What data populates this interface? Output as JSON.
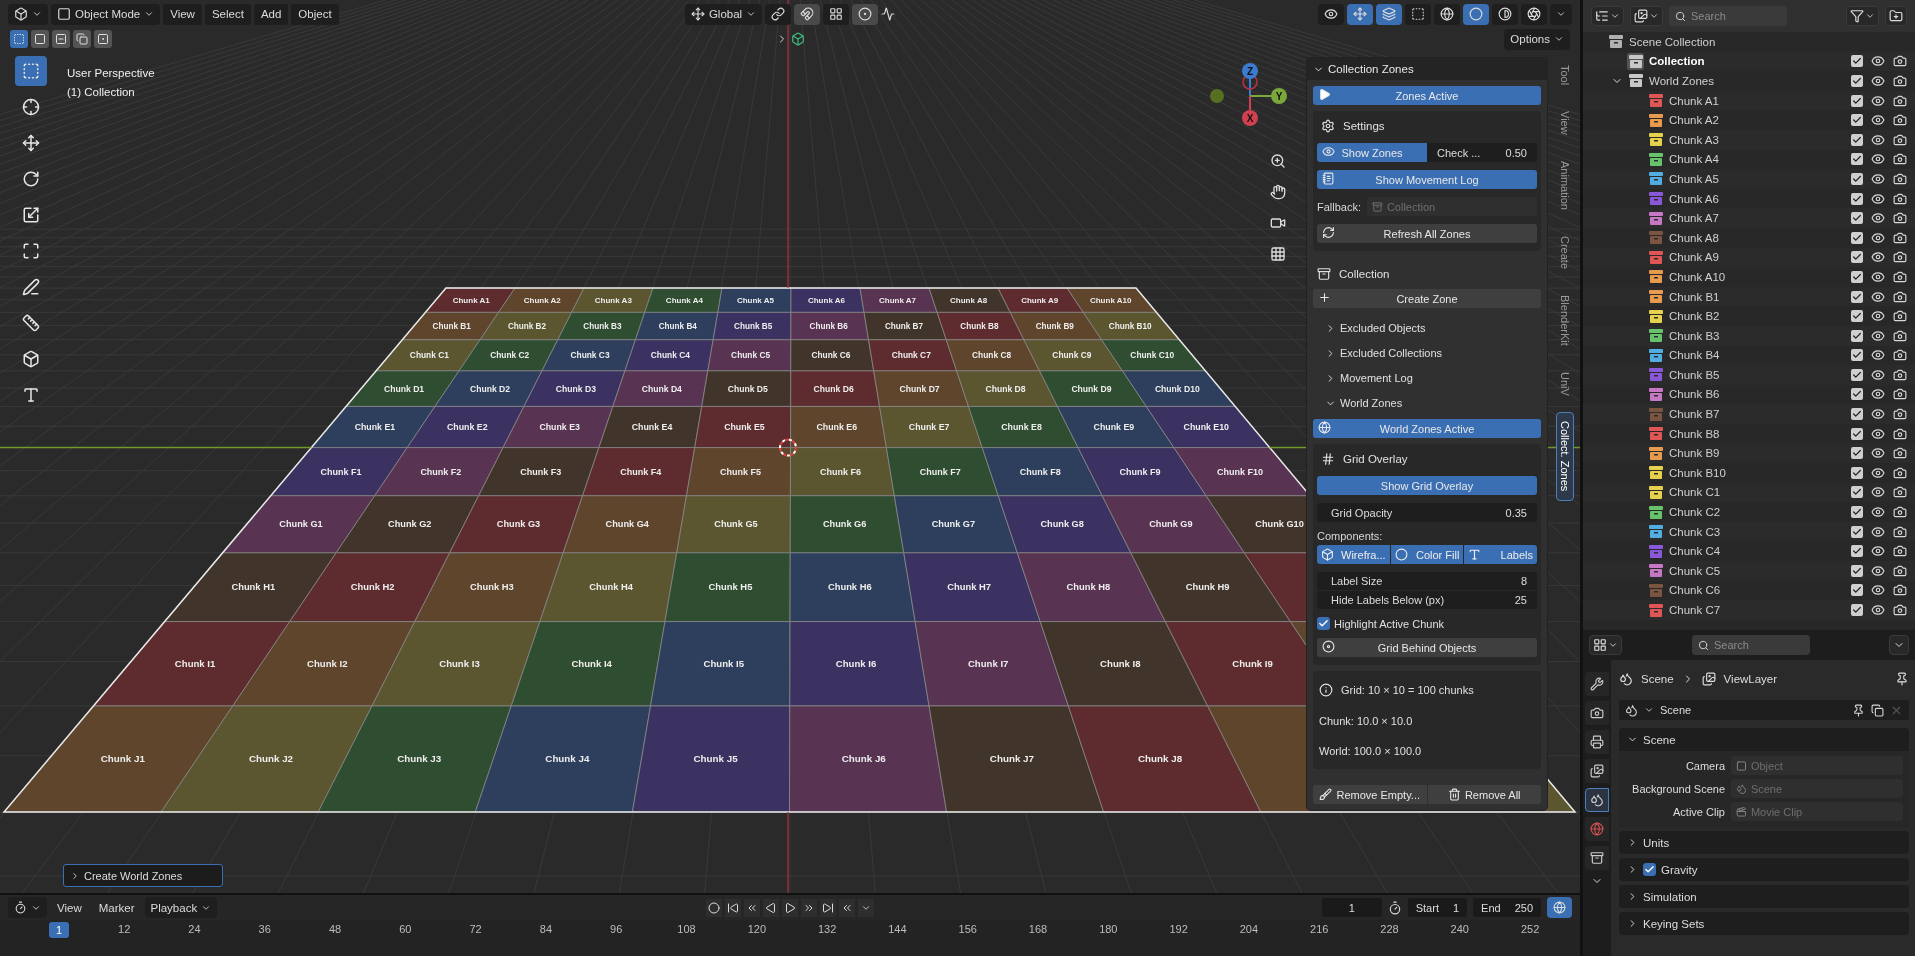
{
  "header": {
    "mode": "Object Mode",
    "menus": [
      "View",
      "Select",
      "Add",
      "Object"
    ],
    "orientation": "Global",
    "center_tools": [
      {
        "kind": "pivot",
        "on": false
      },
      {
        "kind": "snap",
        "on": true
      },
      {
        "kind": "increment",
        "on": false
      },
      {
        "kind": "proportional",
        "on": true
      }
    ],
    "toggles": [
      {
        "kind": "visibility",
        "on": false
      },
      {
        "kind": "gizmo",
        "on": true
      },
      {
        "kind": "overlay",
        "on": true
      },
      {
        "kind": "xray",
        "on": false
      }
    ],
    "shading": [
      {
        "kind": "wireframe",
        "selected": false
      },
      {
        "kind": "solid",
        "selected": true
      },
      {
        "kind": "material",
        "selected": false
      },
      {
        "kind": "rendered",
        "selected": false
      }
    ]
  },
  "select_modes": [
    {
      "selected": true
    },
    {
      "selected": false
    },
    {
      "selected": false
    },
    {
      "selected": false
    },
    {
      "selected": false
    }
  ],
  "options": "Options",
  "viewport": {
    "perspective": "User Perspective",
    "collection": "(1) Collection",
    "gizmo_axes": [
      "Z",
      "Y",
      "X"
    ],
    "redo_panel": "Create World Zones"
  },
  "tools": [
    {
      "kind": "select",
      "selected": true
    },
    {
      "kind": "cursor",
      "selected": false
    },
    {
      "kind": "move",
      "selected": false
    },
    {
      "kind": "rotate",
      "selected": false
    },
    {
      "kind": "scale",
      "selected": false
    },
    {
      "kind": "transform",
      "selected": false
    },
    {
      "kind": "annotate",
      "selected": false
    },
    {
      "kind": "measure",
      "selected": false
    },
    {
      "kind": "add-cube",
      "selected": false
    },
    {
      "kind": "uv",
      "selected": false
    }
  ],
  "grid": {
    "rows": [
      {
        "cells": [
          {
            "label": "Chunk A1",
            "color": "#5e2c2e"
          },
          {
            "label": "Chunk A2",
            "color": "#5f452c"
          },
          {
            "label": "Chunk A3",
            "color": "#5b5530"
          },
          {
            "label": "Chunk A4",
            "color": "#2f4d30"
          },
          {
            "label": "Chunk A5",
            "color": "#2d3f5d"
          },
          {
            "label": "Chunk A6",
            "color": "#3c3262"
          },
          {
            "label": "Chunk A7",
            "color": "#583352"
          },
          {
            "label": "Chunk A8",
            "color": "#41342b"
          },
          {
            "label": "Chunk A9",
            "color": "#5e2c2e"
          },
          {
            "label": "Chunk A10",
            "color": "#5f452c"
          }
        ]
      },
      {
        "cells": [
          {
            "label": "Chunk B1",
            "color": "#5f452c"
          },
          {
            "label": "Chunk B2",
            "color": "#5b5530"
          },
          {
            "label": "Chunk B3",
            "color": "#2f4d30"
          },
          {
            "label": "Chunk B4",
            "color": "#2d3f5d"
          },
          {
            "label": "Chunk B5",
            "color": "#3c3262"
          },
          {
            "label": "Chunk B6",
            "color": "#583352"
          },
          {
            "label": "Chunk B7",
            "color": "#41342b"
          },
          {
            "label": "Chunk B8",
            "color": "#5e2c2e"
          },
          {
            "label": "Chunk B9",
            "color": "#5f452c"
          },
          {
            "label": "Chunk B10",
            "color": "#5b5530"
          }
        ]
      },
      {
        "cells": [
          {
            "label": "Chunk C1",
            "color": "#5b5530"
          },
          {
            "label": "Chunk C2",
            "color": "#2f4d30"
          },
          {
            "label": "Chunk C3",
            "color": "#2d3f5d"
          },
          {
            "label": "Chunk C4",
            "color": "#3c3262"
          },
          {
            "label": "Chunk C5",
            "color": "#583352"
          },
          {
            "label": "Chunk C6",
            "color": "#41342b"
          },
          {
            "label": "Chunk C7",
            "color": "#5e2c2e"
          },
          {
            "label": "Chunk C8",
            "color": "#5f452c"
          },
          {
            "label": "Chunk C9",
            "color": "#5b5530"
          },
          {
            "label": "Chunk C10",
            "color": "#2f4d30"
          }
        ]
      },
      {
        "cells": [
          {
            "label": "Chunk D1",
            "color": "#2f4d30"
          },
          {
            "label": "Chunk D2",
            "color": "#2d3f5d"
          },
          {
            "label": "Chunk D3",
            "color": "#3c3262"
          },
          {
            "label": "Chunk D4",
            "color": "#583352"
          },
          {
            "label": "Chunk D5",
            "color": "#41342b"
          },
          {
            "label": "Chunk D6",
            "color": "#5e2c2e"
          },
          {
            "label": "Chunk D7",
            "color": "#5f452c"
          },
          {
            "label": "Chunk D8",
            "color": "#5b5530"
          },
          {
            "label": "Chunk D9",
            "color": "#2f4d30"
          },
          {
            "label": "Chunk D10",
            "color": "#2d3f5d"
          }
        ]
      },
      {
        "cells": [
          {
            "label": "Chunk E1",
            "color": "#2d3f5d"
          },
          {
            "label": "Chunk E2",
            "color": "#3c3262"
          },
          {
            "label": "Chunk E3",
            "color": "#583352"
          },
          {
            "label": "Chunk E4",
            "color": "#41342b"
          },
          {
            "label": "Chunk E5",
            "color": "#5e2c2e"
          },
          {
            "label": "Chunk E6",
            "color": "#5f452c"
          },
          {
            "label": "Chunk E7",
            "color": "#5b5530"
          },
          {
            "label": "Chunk E8",
            "color": "#2f4d30"
          },
          {
            "label": "Chunk E9",
            "color": "#2d3f5d"
          },
          {
            "label": "Chunk E10",
            "color": "#3c3262"
          }
        ]
      },
      {
        "cells": [
          {
            "label": "Chunk F1",
            "color": "#3c3262"
          },
          {
            "label": "Chunk F2",
            "color": "#583352"
          },
          {
            "label": "Chunk F3",
            "color": "#41342b"
          },
          {
            "label": "Chunk F4",
            "color": "#5e2c2e"
          },
          {
            "label": "Chunk F5",
            "color": "#5f452c"
          },
          {
            "label": "Chunk F6",
            "color": "#5b5530"
          },
          {
            "label": "Chunk F7",
            "color": "#2f4d30"
          },
          {
            "label": "Chunk F8",
            "color": "#2d3f5d"
          },
          {
            "label": "Chunk F9",
            "color": "#3c3262"
          },
          {
            "label": "Chunk F10",
            "color": "#583352"
          }
        ]
      },
      {
        "cells": [
          {
            "label": "Chunk G1",
            "color": "#583352"
          },
          {
            "label": "Chunk G2",
            "color": "#41342b"
          },
          {
            "label": "Chunk G3",
            "color": "#5e2c2e"
          },
          {
            "label": "Chunk G4",
            "color": "#5f452c"
          },
          {
            "label": "Chunk G5",
            "color": "#5b5530"
          },
          {
            "label": "Chunk G6",
            "color": "#2f4d30"
          },
          {
            "label": "Chunk G7",
            "color": "#2d3f5d"
          },
          {
            "label": "Chunk G8",
            "color": "#3c3262"
          },
          {
            "label": "Chunk G9",
            "color": "#583352"
          },
          {
            "label": "Chunk G10",
            "color": "#41342b"
          }
        ]
      },
      {
        "cells": [
          {
            "label": "Chunk H1",
            "color": "#41342b"
          },
          {
            "label": "Chunk H2",
            "color": "#5e2c2e"
          },
          {
            "label": "Chunk H3",
            "color": "#5f452c"
          },
          {
            "label": "Chunk H4",
            "color": "#5b5530"
          },
          {
            "label": "Chunk H5",
            "color": "#2f4d30"
          },
          {
            "label": "Chunk H6",
            "color": "#2d3f5d"
          },
          {
            "label": "Chunk H7",
            "color": "#3c3262"
          },
          {
            "label": "Chunk H8",
            "color": "#583352"
          },
          {
            "label": "Chunk H9",
            "color": "#41342b"
          },
          {
            "color": "#5e2c2e"
          }
        ]
      },
      {
        "cells": [
          {
            "label": "Chunk I1",
            "color": "#5e2c2e"
          },
          {
            "label": "Chunk I2",
            "color": "#5f452c"
          },
          {
            "label": "Chunk I3",
            "color": "#5b5530"
          },
          {
            "label": "Chunk I4",
            "color": "#2f4d30"
          },
          {
            "label": "Chunk I5",
            "color": "#2d3f5d"
          },
          {
            "label": "Chunk I6",
            "color": "#3c3262"
          },
          {
            "label": "Chunk I7",
            "color": "#583352"
          },
          {
            "label": "Chunk I8",
            "color": "#41342b"
          },
          {
            "label": "Chunk I9",
            "color": "#5e2c2e"
          },
          {
            "color": "#5f452c"
          }
        ]
      },
      {
        "cells": [
          {
            "label": "Chunk J1",
            "color": "#5f452c"
          },
          {
            "label": "Chunk J2",
            "color": "#5b5530"
          },
          {
            "label": "Chunk J3",
            "color": "#2f4d30"
          },
          {
            "label": "Chunk J4",
            "color": "#2d3f5d"
          },
          {
            "label": "Chunk J5",
            "color": "#3c3262"
          },
          {
            "label": "Chunk J6",
            "color": "#583352"
          },
          {
            "label": "Chunk J7",
            "color": "#41342b"
          },
          {
            "label": "Chunk J8",
            "color": "#5e2c2e"
          },
          {
            "color": "#5f452c"
          },
          {
            "color": "#5b5530"
          }
        ]
      }
    ]
  },
  "side_tabs": [
    {
      "label": "Tool",
      "selected": false
    },
    {
      "label": "View",
      "selected": false
    },
    {
      "label": "Animation",
      "selected": false
    },
    {
      "label": "Create",
      "selected": false
    },
    {
      "label": "BlenderKit",
      "selected": false
    },
    {
      "label": "UniV",
      "selected": false
    },
    {
      "label": "Collect. Zones",
      "selected": true
    }
  ],
  "panel": {
    "title": "Collection Zones",
    "zones_active": {
      "label": "Zones Active",
      "on": true
    },
    "settings": {
      "title": "Settings",
      "show_zones": {
        "label": "Show Zones",
        "on": true
      },
      "check": {
        "label": "Check ...",
        "value": "0.50"
      },
      "movement_log": {
        "label": "Show Movement Log",
        "on": true
      },
      "fallback": {
        "label": "Fallback:",
        "placeholder": "Collection"
      },
      "refresh": "Refresh All Zones"
    },
    "collection_title": "Collection",
    "create_zone": "Create Zone",
    "subpanels": [
      {
        "label": "Excluded Objects",
        "expanded": false
      },
      {
        "label": "Excluded Collections",
        "expanded": false
      },
      {
        "label": "Movement Log",
        "expanded": false
      },
      {
        "label": "World Zones",
        "expanded": true
      }
    ],
    "world_zones_active": {
      "label": "World Zones Active",
      "on": true
    },
    "grid_overlay": {
      "title": "Grid Overlay",
      "show": {
        "label": "Show Grid Overlay",
        "on": true
      },
      "opacity": {
        "label": "Grid Opacity",
        "value": "0.35"
      },
      "components_label": "Components:",
      "components": [
        {
          "kind": "wireframe",
          "label": "Wirefra...",
          "on": true
        },
        {
          "kind": "fill",
          "label": "Color Fill",
          "on": true
        },
        {
          "kind": "labels",
          "label": "Labels",
          "on": true
        }
      ],
      "label_size": {
        "label": "Label Size",
        "value": "8"
      },
      "hide_below": {
        "label": "Hide Labels Below (px)",
        "value": "25"
      },
      "highlight": {
        "label": "Highlight Active Chunk",
        "checked": true
      },
      "behind": {
        "label": "Grid Behind Objects",
        "on": false
      }
    },
    "info": [
      "Grid: 10 × 10 = 100 chunks",
      "Chunk: 10.0 × 10.0",
      "World: 100.0 × 100.0"
    ],
    "footer": [
      {
        "kind": "clean",
        "label": "Remove Empty..."
      },
      {
        "kind": "delete",
        "label": "Remove All"
      }
    ]
  },
  "outliner": {
    "search": {
      "placeholder": "Search"
    },
    "items": [
      {
        "label": "Scene Collection",
        "kind": "scene",
        "children": [
          {
            "label": "Collection",
            "kind": "collection",
            "active": true,
            "checked": true
          },
          {
            "label": "World Zones",
            "kind": "collection",
            "active": false,
            "checked": true,
            "expanded": true,
            "children": [
              {
                "label": "Chunk A1",
                "kind": "collection",
                "color": "#e05656",
                "checked": true
              },
              {
                "label": "Chunk A2",
                "kind": "collection",
                "color": "#e89a4e",
                "checked": true
              },
              {
                "label": "Chunk A3",
                "kind": "collection",
                "color": "#e6d14c",
                "checked": true
              },
              {
                "label": "Chunk A4",
                "kind": "collection",
                "color": "#66c26b",
                "checked": true
              },
              {
                "label": "Chunk A5",
                "kind": "collection",
                "color": "#52aee2",
                "checked": true
              },
              {
                "label": "Chunk A6",
                "kind": "collection",
                "color": "#8b57d9",
                "checked": true
              },
              {
                "label": "Chunk A7",
                "kind": "collection",
                "color": "#c877c4",
                "checked": true
              },
              {
                "label": "Chunk A8",
                "kind": "collection",
                "color": "#7b5442",
                "checked": true
              },
              {
                "label": "Chunk A9",
                "kind": "collection",
                "color": "#e05656",
                "checked": true
              },
              {
                "label": "Chunk A10",
                "kind": "collection",
                "color": "#e89a4e",
                "checked": true
              },
              {
                "label": "Chunk B1",
                "kind": "collection",
                "color": "#e89a4e",
                "checked": true
              },
              {
                "label": "Chunk B2",
                "kind": "collection",
                "color": "#e6d14c",
                "checked": true
              },
              {
                "label": "Chunk B3",
                "kind": "collection",
                "color": "#66c26b",
                "checked": true
              },
              {
                "label": "Chunk B4",
                "kind": "collection",
                "color": "#52aee2",
                "checked": true
              },
              {
                "label": "Chunk B5",
                "kind": "collection",
                "color": "#8b57d9",
                "checked": true
              },
              {
                "label": "Chunk B6",
                "kind": "collection",
                "color": "#c877c4",
                "checked": true
              },
              {
                "label": "Chunk B7",
                "kind": "collection",
                "color": "#7b5442",
                "checked": true
              },
              {
                "label": "Chunk B8",
                "kind": "collection",
                "color": "#e05656",
                "checked": true
              },
              {
                "label": "Chunk B9",
                "kind": "collection",
                "color": "#e89a4e",
                "checked": true
              },
              {
                "label": "Chunk B10",
                "kind": "collection",
                "color": "#e6d14c",
                "checked": true
              },
              {
                "label": "Chunk C1",
                "kind": "collection",
                "color": "#e6d14c",
                "checked": true
              },
              {
                "label": "Chunk C2",
                "kind": "collection",
                "color": "#66c26b",
                "checked": true
              },
              {
                "label": "Chunk C3",
                "kind": "collection",
                "color": "#52aee2",
                "checked": true
              },
              {
                "label": "Chunk C4",
                "kind": "collection",
                "color": "#8b57d9",
                "checked": true
              },
              {
                "label": "Chunk C5",
                "kind": "collection",
                "color": "#c877c4",
                "checked": true
              },
              {
                "label": "Chunk C6",
                "kind": "collection",
                "color": "#7b5442",
                "checked": true
              },
              {
                "label": "Chunk C7",
                "kind": "collection",
                "color": "#e05656",
                "checked": true
              }
            ]
          }
        ]
      }
    ]
  },
  "properties": {
    "search": {
      "placeholder": "Search"
    },
    "breadcrumb": [
      "Scene",
      "ViewLayer"
    ],
    "scene_field": "Scene",
    "tabs": [
      {
        "kind": "tool",
        "selected": false
      },
      {
        "kind": "render",
        "selected": false
      },
      {
        "kind": "output",
        "selected": false
      },
      {
        "kind": "view-layer",
        "selected": false
      },
      {
        "kind": "scene",
        "selected": true
      },
      {
        "kind": "world",
        "selected": false
      },
      {
        "kind": "collection",
        "selected": false
      }
    ],
    "sections": [
      {
        "title": "Scene",
        "expanded": true,
        "fields": [
          {
            "kind": "object",
            "label": "Camera",
            "placeholder": "Object"
          },
          {
            "kind": "scene",
            "label": "Background Scene",
            "placeholder": "Scene"
          },
          {
            "kind": "clip",
            "label": "Active Clip",
            "placeholder": "Movie Clip"
          }
        ]
      },
      {
        "title": "Units",
        "expanded": false
      },
      {
        "title": "Gravity",
        "expanded": false,
        "checked": true
      },
      {
        "title": "Simulation",
        "expanded": false
      },
      {
        "title": "Keying Sets",
        "expanded": false
      }
    ]
  },
  "timeline": {
    "menus": [
      "View",
      "Marker"
    ],
    "playback": "Playback",
    "current_frame": "1",
    "start_label": "Start",
    "start": "1",
    "end_label": "End",
    "end": "250",
    "playhead": "1",
    "ruler": [
      "12",
      "24",
      "36",
      "48",
      "60",
      "72",
      "84",
      "96",
      "108",
      "120",
      "132",
      "144",
      "156",
      "168",
      "180",
      "192",
      "204",
      "216",
      "228",
      "240",
      "252"
    ]
  }
}
